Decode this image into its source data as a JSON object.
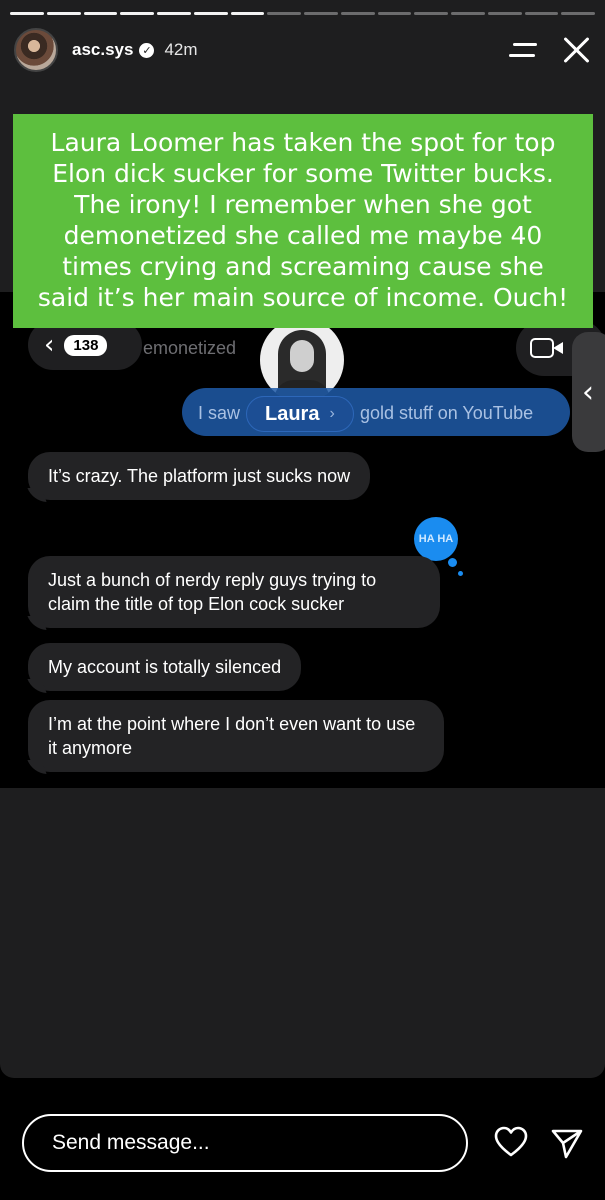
{
  "progress": {
    "segments": 16,
    "completed": 7
  },
  "header": {
    "username": "asc.sys",
    "verified_mark": "✓",
    "time": "42m"
  },
  "caption": {
    "text": "Laura Loomer has taken the spot for top Elon dick sucker for some Twitter bucks. The irony! I remember when she got demonetized she called me maybe 40 times crying and screaming cause she said it’s her main source of income. Ouch!"
  },
  "chat": {
    "back_glyph": "‹",
    "unread_count": "138",
    "ghost_text": "emonetized",
    "contact_name": "Laura",
    "contact_chevron": "›",
    "sent_left": "I saw",
    "sent_right": "gold stuff on YouTube",
    "reaction": "HA HA",
    "side_glyph": "‹",
    "messages": [
      "It’s crazy. The platform just sucks now",
      "Just a bunch of nerdy reply guys trying to claim the title of top Elon cock sucker",
      "My account is totally silenced",
      "I’m at the point where I don’t even want to use it anymore"
    ]
  },
  "footer": {
    "send_placeholder": "Send message..."
  },
  "colors": {
    "caption_bg": "#5dbf3e",
    "sent_bubble": "#1f5aa8",
    "received_bubble": "#232325",
    "reaction": "#1a8cf0"
  },
  "icons": [
    "menu-icon",
    "close-icon",
    "chevron-left-icon",
    "video-call-icon",
    "heart-icon",
    "send-icon"
  ]
}
